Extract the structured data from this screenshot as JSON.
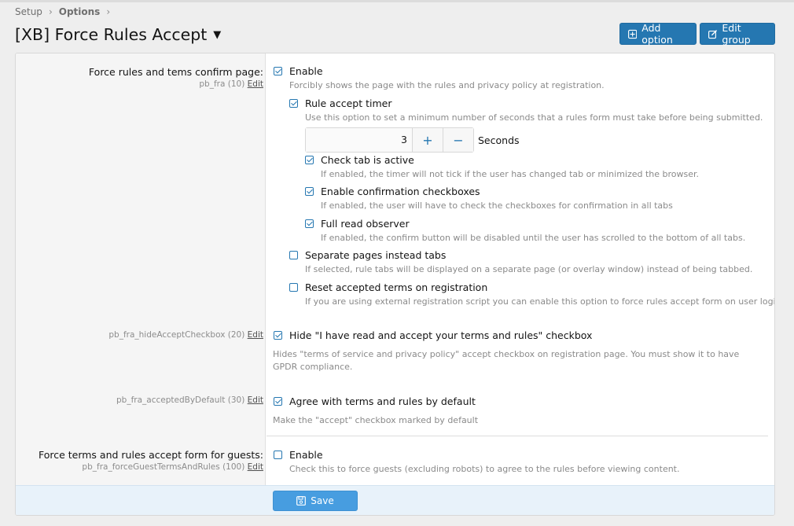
{
  "breadcrumb": [
    "Setup",
    "Options"
  ],
  "page_title": "[XB] Force Rules Accept",
  "buttons": {
    "add_option": "Add option",
    "edit_group": "Edit group",
    "save": "Save"
  },
  "rows": {
    "main": {
      "label": "Force rules and tems confirm page:",
      "key": "pb_fra (10)",
      "edit": "Edit",
      "enable_label": "Enable",
      "enable_hint": "Forcibly shows the page with the rules and privacy policy at registration.",
      "timer_label": "Rule accept timer",
      "timer_hint": "Use this option to set a minimum number of seconds that a rules form must take before being submitted.",
      "timer_value": "3",
      "timer_unit": "Seconds",
      "tab_active_label": "Check tab is active",
      "tab_active_hint": "If enabled, the timer will not tick if the user has changed tab or minimized the browser.",
      "confirm_cb_label": "Enable confirmation checkboxes",
      "confirm_cb_hint": "If enabled, the user will have to check the checkboxes for confirmation in all tabs",
      "full_read_label": "Full read observer",
      "full_read_hint": "If enabled, the confirm button will be disabled until the user has scrolled to the bottom of all tabs.",
      "separate_label": "Separate pages instead tabs",
      "separate_hint": "If selected, rule tabs will be displayed on a separate page (or overlay window) instead of being tabbed.",
      "reset_label": "Reset accepted terms on registration",
      "reset_hint": "If you are using external registration script you can enable this option to force rules accept form on user login."
    },
    "hide": {
      "key": "pb_fra_hideAcceptCheckbox (20)",
      "edit": "Edit",
      "label": "Hide \"I have read and accept your terms and rules\" checkbox",
      "hint": "Hides \"terms of service and privacy policy\" accept checkbox on registration page. You must show it to have GPDR compliance."
    },
    "default": {
      "key": "pb_fra_acceptedByDefault (30)",
      "edit": "Edit",
      "label": "Agree with terms and rules by default",
      "hint": "Make the \"accept\" checkbox marked by default"
    },
    "guests": {
      "label": "Force terms and rules accept form for guests:",
      "key": "pb_fra_forceGuestTermsAndRules (100)",
      "edit": "Edit",
      "enable_label": "Enable",
      "enable_hint": "Check this to force guests (excluding robots) to agree to the rules before viewing content."
    }
  },
  "checks": {
    "main_enable": true,
    "timer": true,
    "tab_active": true,
    "confirm_cb": true,
    "full_read": true,
    "separate": false,
    "reset": false,
    "hide": true,
    "default": true,
    "guests": false
  },
  "colors": {
    "accent": "#2577b1",
    "save": "#479de0"
  }
}
